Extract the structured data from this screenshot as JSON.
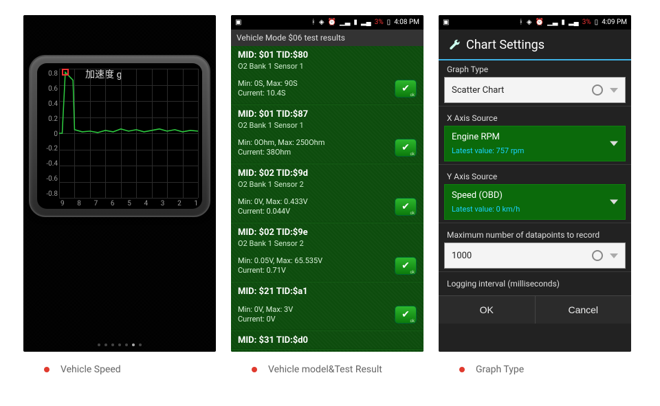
{
  "panel1": {
    "chart_title": "加速度 g",
    "y_ticks": [
      "0.8",
      "0.6",
      "0.4",
      "0.2",
      "0",
      "-0.2",
      "-0.4",
      "-0.6",
      "-0.8"
    ],
    "x_ticks": [
      "9",
      "8",
      "7",
      "6",
      "5",
      "4",
      "3",
      "2",
      "1"
    ]
  },
  "chart_data": {
    "type": "line",
    "title": "加速度 g",
    "xlabel": "",
    "ylabel": "",
    "ylim": [
      -0.9,
      0.9
    ],
    "xlim": [
      9.5,
      0.5
    ],
    "x": [
      9.5,
      9.3,
      9.1,
      8.6,
      8.5,
      8.0,
      7.5,
      7.0,
      6.5,
      6.0,
      5.5,
      5.0,
      4.5,
      4.0,
      3.5,
      3.0,
      2.5,
      2.0,
      1.5,
      1.0,
      0.5
    ],
    "y": [
      0.0,
      0.0,
      0.85,
      0.74,
      0.05,
      0.02,
      0.03,
      0.01,
      0.04,
      0.02,
      0.06,
      0.03,
      0.05,
      0.02,
      0.04,
      0.06,
      0.03,
      0.05,
      0.02,
      0.04,
      0.03
    ],
    "marker": {
      "x": 9.1,
      "y": 0.85
    }
  },
  "panel2": {
    "status": {
      "batt": "3%",
      "time": "4:08 PM"
    },
    "bar": "Vehicle Mode $06 test results",
    "rows": [
      {
        "mid": "MID: $01 TID:$80",
        "sub": "O2 Bank 1 Sensor 1",
        "min": "Min: 0S, Max: 90S",
        "cur": "Current: 10.4S",
        "ok": "ok"
      },
      {
        "mid": "MID: $01 TID:$87",
        "sub": "O2 Bank 1 Sensor 1",
        "min": "Min: 0Ohm, Max: 250Ohm",
        "cur": "Current: 38Ohm",
        "ok": "ok"
      },
      {
        "mid": "MID: $02 TID:$9d",
        "sub": "O2 Bank 1 Sensor 2",
        "min": "Min: 0V, Max: 0.433V",
        "cur": "Current: 0.044V",
        "ok": "ok"
      },
      {
        "mid": "MID: $02 TID:$9e",
        "sub": "O2 Bank 1 Sensor 2",
        "min": "Min: 0.05V, Max: 65.535V",
        "cur": "Current: 0.71V",
        "ok": "ok"
      },
      {
        "mid": "MID: $21 TID:$a1",
        "sub": "",
        "min": "Min: 0V, Max: 3V",
        "cur": "Current: 0V",
        "ok": "ok"
      },
      {
        "mid": "MID: $31 TID:$d0",
        "sub": "",
        "min": "",
        "cur": "",
        "ok": ""
      }
    ]
  },
  "panel3": {
    "status": {
      "batt": "3%",
      "time": "4:09 PM"
    },
    "title": "Chart Settings",
    "graph_type_label": "Graph Type",
    "graph_type_value": "Scatter Chart",
    "x_label": "X Axis Source",
    "x_value": "Engine RPM",
    "x_sub": "Latest value: 757 rpm",
    "y_label": "Y Axis Source",
    "y_value": "Speed (OBD)",
    "y_sub": "Latest value: 0 km/h",
    "max_label": "Maximum number of datapoints to record",
    "max_value": "1000",
    "interval_label": "Logging interval (milliseconds)",
    "ok": "OK",
    "cancel": "Cancel"
  },
  "captions": {
    "c1": "Vehicle Speed",
    "c2": "Vehicle model&Test Result",
    "c3": "Graph Type"
  }
}
